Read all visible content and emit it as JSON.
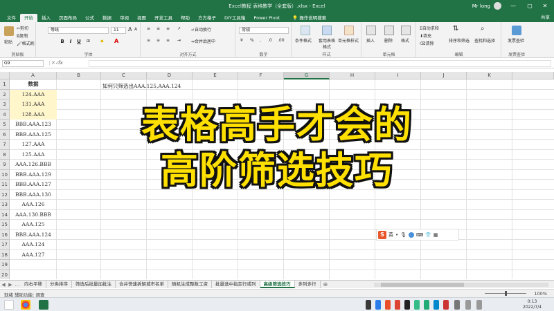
{
  "window": {
    "title": "Excel教程 表格教学（全套版）.xlsx - Excel",
    "user": "Mr long",
    "minimize": "—",
    "restore": "▢",
    "close": "✕"
  },
  "ribbon_tabs": [
    "文件",
    "开始",
    "插入",
    "页面布局",
    "公式",
    "数据",
    "审阅",
    "视图",
    "开发工具",
    "帮助",
    "方方格子",
    "DIY工具箱",
    "Power Pivot"
  ],
  "active_tab": "开始",
  "tell_me": "操作说明搜索",
  "share": "共享",
  "ribbon": {
    "clipboard": {
      "label": "剪贴板",
      "paste": "粘贴",
      "cut": "剪切",
      "copy": "复制",
      "format_painter": "格式刷"
    },
    "font": {
      "label": "字体",
      "name": "等线",
      "size": "11",
      "bold": "B",
      "italic": "I",
      "underline": "U"
    },
    "alignment": {
      "label": "对齐方式",
      "wrap": "自动换行",
      "merge": "合并后居中"
    },
    "number": {
      "label": "数字",
      "format": "常规"
    },
    "styles": {
      "label": "样式",
      "conditional": "条件格式",
      "as_table": "套用表格格式",
      "cell_styles": "单元格样式"
    },
    "cells": {
      "label": "单元格",
      "insert": "插入",
      "delete": "删除",
      "format": "格式"
    },
    "editing": {
      "label": "编辑",
      "autosum": "自动求和",
      "fill": "填充",
      "clear": "清除",
      "sort_filter": "排序和筛选",
      "find": "查找和选择"
    },
    "invoice": {
      "label": "发票查验",
      "check": "发票查验"
    }
  },
  "namebox": "G9",
  "fx": "fx",
  "columns": [
    "A",
    "B",
    "C",
    "D",
    "E",
    "F",
    "G",
    "H",
    "I",
    "J",
    "K"
  ],
  "selected_column": "G",
  "rows": [
    "1",
    "2",
    "3",
    "4",
    "5",
    "6",
    "7",
    "8",
    "9",
    "10",
    "11",
    "12",
    "13",
    "14",
    "15",
    "16",
    "17",
    "18",
    "19",
    "20"
  ],
  "column_a": [
    "数据",
    "124.AAA",
    "131.AAA",
    "128.AAA",
    "BBB.AAA.123",
    "BBB.AAA.125",
    "127.AAA",
    "125.AAA",
    "AAA.126.BBB",
    "BBB.AAA.129",
    "BBB.AAA.127",
    "BBB.AAA.130",
    "AAA.126",
    "AAA.130.BBB",
    "AAA.125",
    "BBB.AAA.124",
    "AAA.124",
    "AAA.127"
  ],
  "note": "如何只筛选出AAA.125,AAA.124",
  "overlay": {
    "line1": "表格高手才会的",
    "line2": "高阶筛选技巧"
  },
  "ime": {
    "logo": "S",
    "mode": "英"
  },
  "sheet_tabs": [
    "向右平移",
    "分类排序",
    "筛选后批量加批注",
    "合并快速拆解城市名单",
    "随机生成整数工资",
    "批量选中指定行或列",
    "高级筛选技巧",
    "多列多行"
  ],
  "active_sheet": "高级筛选技巧",
  "nav": {
    "prev": "◀",
    "next": "▶",
    "more": "…",
    "add": "⊕"
  },
  "status": {
    "left": "就绪   辅助功能: 调查",
    "zoom": "100%"
  },
  "clock": {
    "time": "0:13",
    "date": "2022/7/4"
  },
  "colors": {
    "excel_green": "#217346",
    "overlay_yellow": "#ffe000",
    "highlight": "#fff6cc"
  }
}
